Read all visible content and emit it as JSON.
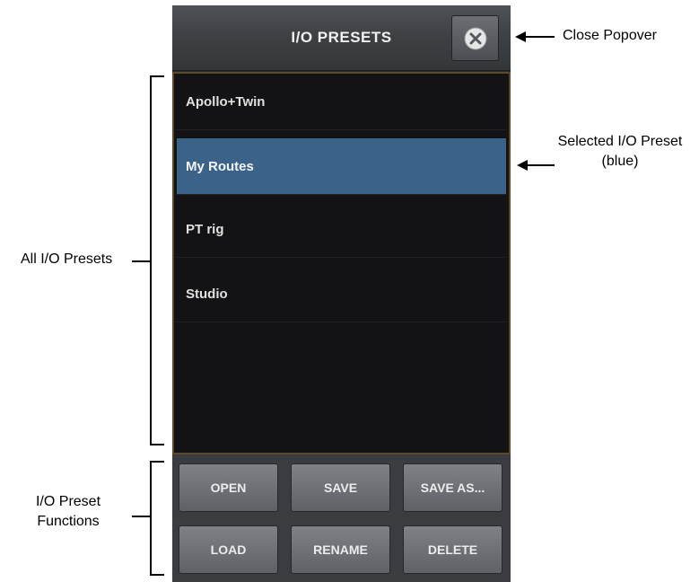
{
  "popover": {
    "title": "I/O PRESETS",
    "close_icon": "close-icon"
  },
  "presets": [
    {
      "label": "Apollo+Twin",
      "selected": false
    },
    {
      "label": "My Routes",
      "selected": true
    },
    {
      "label": "PT rig",
      "selected": false
    },
    {
      "label": "Studio",
      "selected": false
    }
  ],
  "functions": {
    "open": "OPEN",
    "save": "SAVE",
    "save_as": "SAVE AS...",
    "load": "LOAD",
    "rename": "RENAME",
    "delete": "DELETE"
  },
  "annotations": {
    "close_popover": "Close Popover",
    "selected_preset_line1": "Selected I/O Preset",
    "selected_preset_line2": "(blue)",
    "all_presets": "All I/O Presets",
    "functions_line1": "I/O Preset",
    "functions_line2": "Functions"
  },
  "colors": {
    "selected": "#3b6289",
    "list_bg": "#131315",
    "list_border": "#5b4a2a"
  }
}
